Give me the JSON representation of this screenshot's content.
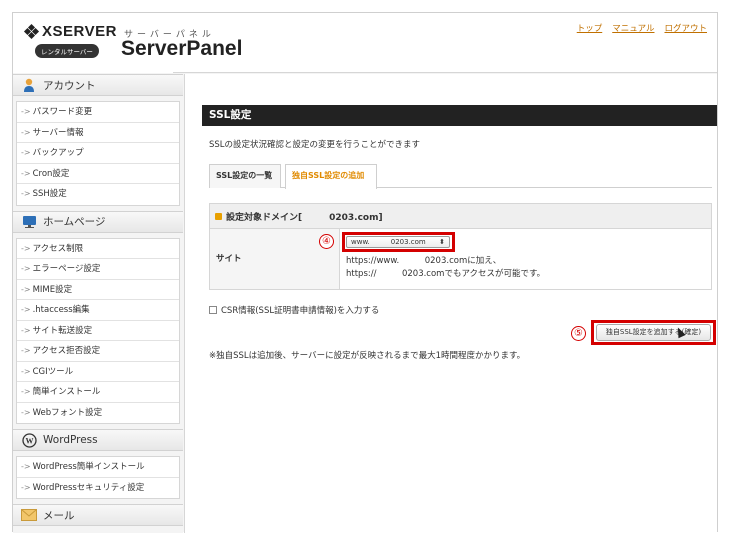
{
  "header": {
    "brand_name": "XSERVER",
    "rental_badge": "レンタルサーバー",
    "kana": "サーバーパネル",
    "product": "ServerPanel",
    "links": [
      "トップ",
      "マニュアル",
      "ログアウト"
    ]
  },
  "sidebar": {
    "sections": [
      {
        "title": "アカウント",
        "icon": "person-icon",
        "items": [
          "パスワード変更",
          "サーバー情報",
          "バックアップ",
          "Cron設定",
          "SSH設定"
        ]
      },
      {
        "title": "ホームページ",
        "icon": "monitor-icon",
        "items": [
          "アクセス制限",
          "エラーページ設定",
          "MIME設定",
          ".htaccess編集",
          "サイト転送設定",
          "アクセス拒否設定",
          "CGIツール",
          "簡単インストール",
          "Webフォント設定"
        ]
      },
      {
        "title": "WordPress",
        "icon": "wordpress-icon",
        "items": [
          "WordPress簡単インストール",
          "WordPressセキュリティ設定"
        ]
      },
      {
        "title": "メール",
        "icon": "mail-icon",
        "items": []
      }
    ]
  },
  "main": {
    "title": "SSL設定",
    "description": "SSLの設定状況確認と設定の変更を行うことができます",
    "tabs": [
      {
        "label": "SSL設定の一覧",
        "active": false
      },
      {
        "label": "独自SSL設定の追加",
        "active": true
      }
    ],
    "domain_header": "設定対象ドメイン[　　　0203.com]",
    "site_label": "サイト",
    "site_select_value": "www.　　　0203.com",
    "site_info_line1": "https://www.　　　0203.comに加え、",
    "site_info_line2": "https://　　　0203.comでもアクセスが可能です。",
    "csr_label": "CSR情報(SSL証明書申請情報)を入力する",
    "confirm_button": "独自SSL設定を追加する(確定)",
    "note": "※独自SSLは追加後、サーバーに設定が反映されるまで最大1時間程度かかります。",
    "step_markers": [
      "④",
      "⑤"
    ]
  },
  "colors": {
    "accent": "#e08a00",
    "highlight": "#d40000",
    "title_bar": "#222222"
  }
}
